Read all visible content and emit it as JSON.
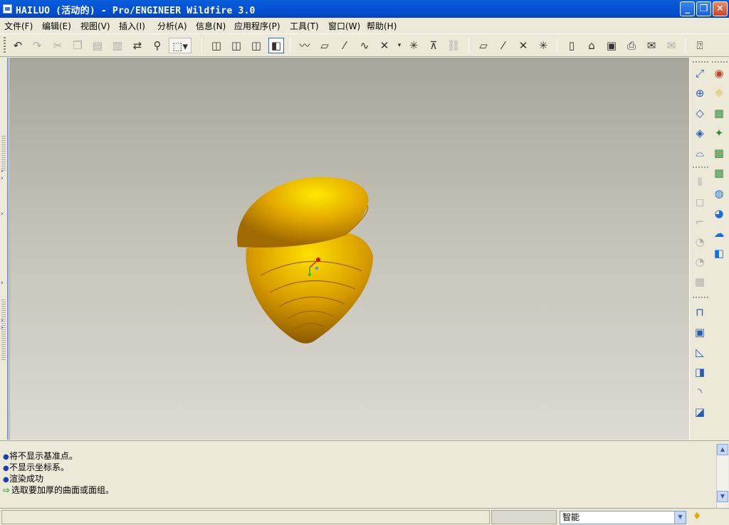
{
  "window": {
    "title": "HAILUO (活动的) - Pro/ENGINEER Wildfire 3.0",
    "buttons": {
      "minimize": "_",
      "maximize": "❐",
      "close": "✕"
    }
  },
  "menu": [
    "文件(F)",
    "编辑(E)",
    "视图(V)",
    "插入(I)",
    "分析(A)",
    "信息(N)",
    "应用程序(P)",
    "工具(T)",
    "窗口(W)",
    "帮助(H)"
  ],
  "messages": [
    {
      "type": "info",
      "text": "将不显示基准点。"
    },
    {
      "type": "info",
      "text": "不显示坐标系。"
    },
    {
      "type": "info",
      "text": "渲染成功"
    },
    {
      "type": "prompt",
      "text": "选取要加厚的曲面或面组。"
    }
  ],
  "status": {
    "filter_value": "智能"
  },
  "colors": {
    "model": "#e0a800",
    "model_highlight": "#ffe400",
    "title_bar": "#0555d8",
    "chrome": "#ece9d8"
  }
}
